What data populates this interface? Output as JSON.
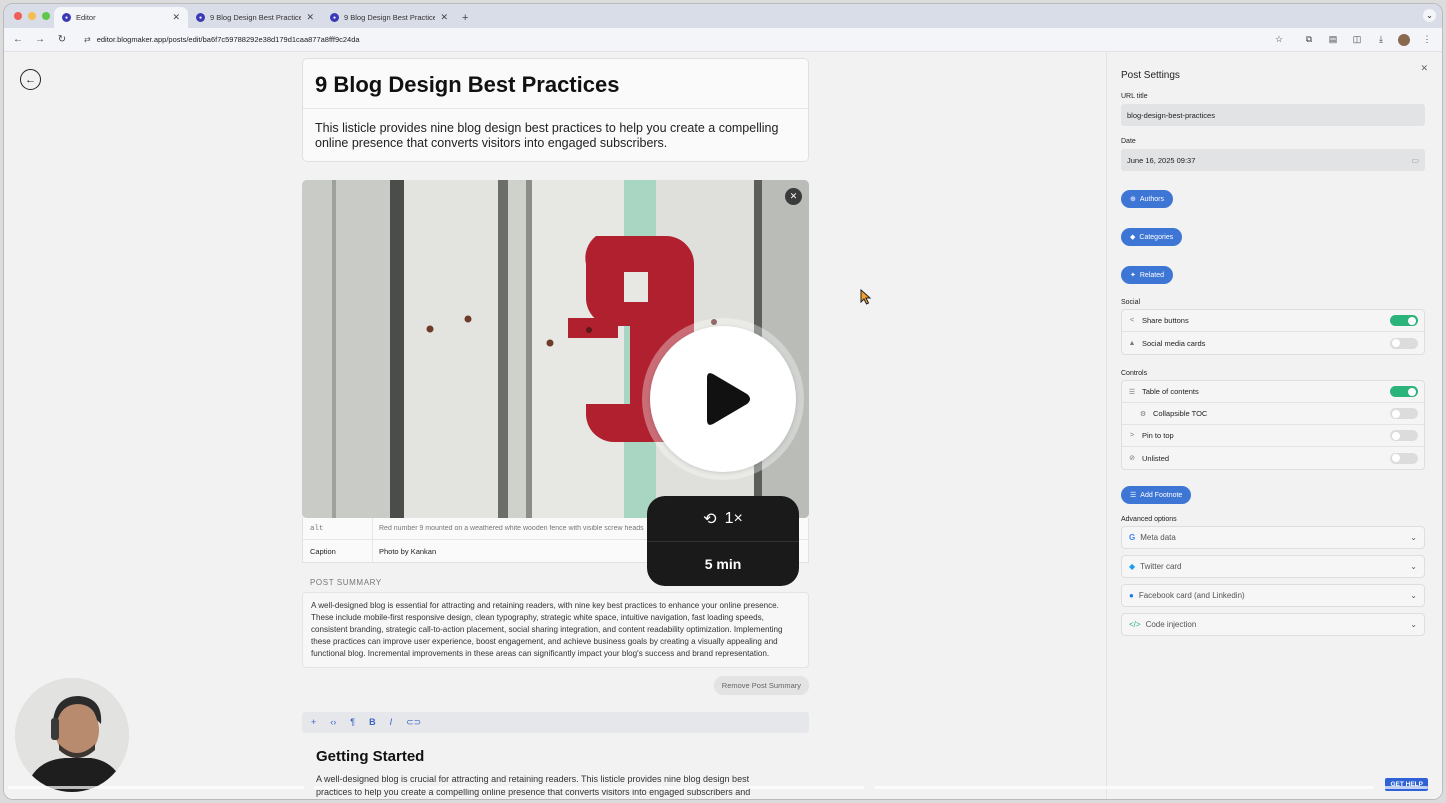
{
  "browser": {
    "tabs": [
      {
        "title": "Editor",
        "active": true
      },
      {
        "title": "9 Blog Design Best Practices",
        "active": false
      },
      {
        "title": "9 Blog Design Best Practices",
        "active": false
      }
    ],
    "url": "editor.blogmaker.app/posts/edit/ba6f7c59788292e38d179d1caa877a8fff9c24da"
  },
  "editor": {
    "title": "9 Blog Design Best Practices",
    "subtitle": "This listicle provides nine blog design best practices to help you create a compelling online presence that converts visitors into engaged subscribers.",
    "image_meta": {
      "alt_key": "alt",
      "alt_value": "Red number 9 mounted on a weathered white wooden fence with visible screw heads",
      "caption_key": "Caption",
      "caption_value": "Photo by Kankan"
    },
    "summary_label": "POST SUMMARY",
    "summary": "A well-designed blog is essential for attracting and retaining readers, with nine key best practices to enhance your online presence. These include mobile-first responsive design, clean typography, strategic white space, intuitive navigation, fast loading speeds, consistent branding, strategic call-to-action placement, social sharing integration, and content readability optimization. Implementing these practices can improve user experience, boost engagement, and achieve business goals by creating a visually appealing and functional blog. Incremental improvements in these areas can significantly impact your blog's success and brand representation.",
    "remove_summary": "Remove Post Summary",
    "section_heading": "Getting Started",
    "section_body": "A well-designed blog is crucial for attracting and retaining readers. This listicle provides nine blog design best practices to help you create a compelling online presence that converts visitors into engaged subscribers and"
  },
  "settings": {
    "title": "Post Settings",
    "url_title_label": "URL title",
    "url_title_value": "blog-design-best-practices",
    "date_label": "Date",
    "date_value": "June 16, 2025 09:37",
    "authors_button": "Authors",
    "categories_button": "Categories",
    "related_button": "Related",
    "social_label": "Social",
    "social": [
      {
        "label": "Share buttons",
        "on": true
      },
      {
        "label": "Social media cards",
        "on": false
      }
    ],
    "controls_label": "Controls",
    "controls": [
      {
        "label": "Table of contents",
        "on": true
      },
      {
        "label": "Collapsible TOC",
        "on": false
      },
      {
        "label": "Pin to top",
        "on": false
      },
      {
        "label": "Unlisted",
        "on": false
      }
    ],
    "add_footnote": "Add Footnote",
    "advanced_label": "Advanced options",
    "advanced": [
      {
        "label": "Meta data"
      },
      {
        "label": "Twitter card"
      },
      {
        "label": "Facebook card (and Linkedin)"
      },
      {
        "label": "Code injection"
      }
    ],
    "get_help": "GET HELP"
  },
  "overlay": {
    "speed": "1×",
    "duration": "5 min"
  },
  "colors": {
    "accent": "#3e76d6",
    "toggle_on": "#2bb37b",
    "red_nine": "#b0202e"
  }
}
